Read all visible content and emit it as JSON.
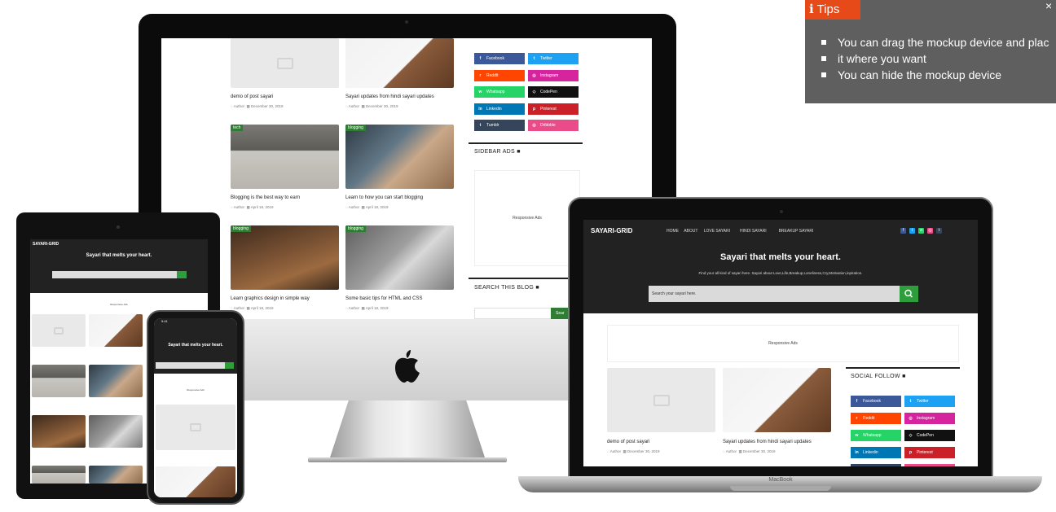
{
  "site": {
    "brand": "SAYARI-GRID",
    "nav": [
      "HOME",
      "ABOUT",
      "LOVE SAYARI",
      "HINDI SAYARI",
      "BREAKUP SAYARI"
    ],
    "hero_title": "Sayari that melts your heart.",
    "hero_subtitle": "Find your all kind of sayari here. Sayari about Love,Life,Breakup,Loneliness,Cry,Motivation,inpiration.",
    "search_placeholder": "Search your sayari here.",
    "ads_label": "Responsive Ads",
    "social_follow_heading": "SOCIAL FOLLOW ■",
    "sidebar_ads_heading": "SIDEBAR ADS ■",
    "search_blog_heading": "SEARCH THIS BLOG ■",
    "search_button_partial": "Sear"
  },
  "posts": [
    {
      "title": "demo of post sayari",
      "author": "Author",
      "date": "December 30, 2019",
      "tag": ""
    },
    {
      "title": "Sayari updates from hindi sayari updates",
      "author": "Author",
      "date": "December 30, 2019",
      "tag": ""
    },
    {
      "title": "Blogging is the best way to earn",
      "author": "Author",
      "date": "April 18, 2019",
      "tag": "tech"
    },
    {
      "title": "Learn to how you can start blogging",
      "author": "Author",
      "date": "April 18, 2019",
      "tag": "blogging"
    },
    {
      "title": "Learn graphics design in simple way",
      "author": "Author",
      "date": "April 18, 2019",
      "tag": "blogging"
    },
    {
      "title": "Some basic tips for HTML and CSS",
      "author": "Author",
      "date": "April 18, 2019",
      "tag": "blogging"
    }
  ],
  "social": [
    {
      "label": "Facebook",
      "color": "#3b5998",
      "icon": "f"
    },
    {
      "label": "Twitter",
      "color": "#1da1f2",
      "icon": "t"
    },
    {
      "label": "Reddit",
      "color": "#ff4500",
      "icon": "r"
    },
    {
      "label": "Instagram",
      "color": "#d6249f",
      "icon": "◎"
    },
    {
      "label": "Whatsapp",
      "color": "#25d366",
      "icon": "w"
    },
    {
      "label": "CodePen",
      "color": "#111111",
      "icon": "◇"
    },
    {
      "label": "Linkedin",
      "color": "#0077b5",
      "icon": "in"
    },
    {
      "label": "Pinterest",
      "color": "#cb2027",
      "icon": "p"
    },
    {
      "label": "Tumblr",
      "color": "#35465c",
      "icon": "t"
    },
    {
      "label": "Dribbble",
      "color": "#ea4c89",
      "icon": "◎"
    }
  ],
  "laptop": {
    "brand": "MacBook"
  },
  "phone": {
    "time": "9:41"
  },
  "tips": {
    "heading": "Tips",
    "close": "×",
    "items": [
      "You can drag the mockup device and plac",
      "it where you want",
      "You can hide the mockup device"
    ]
  }
}
